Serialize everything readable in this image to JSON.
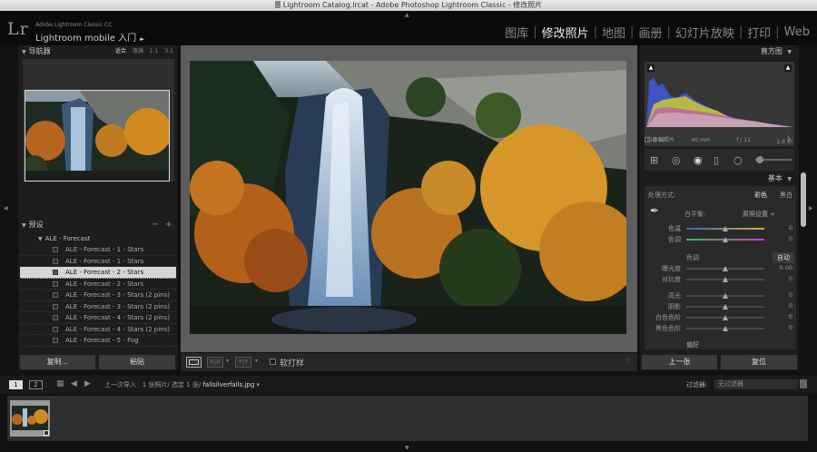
{
  "window": {
    "title": "Lightroom Catalog.lrcat - Adobe Photoshop Lightroom Classic - 修改照片"
  },
  "brand": {
    "logo": "Lr",
    "small": "Adobe Lightroom Classic CC",
    "big": "Lightroom mobile 入门",
    "arrow": "►"
  },
  "modules": [
    "图库",
    "修改照片",
    "地图",
    "画册",
    "幻灯片放映",
    "打印",
    "Web"
  ],
  "active_module": "修改照片",
  "navigator": {
    "title": "导航器",
    "options": [
      "适合",
      "填满",
      "1:1",
      "3:1"
    ],
    "selected_option": "适合"
  },
  "presets": {
    "title": "预设",
    "minus": "−",
    "plus": "+",
    "folder": "ALE - Forecast",
    "items": [
      "ALE - Forecast - 1 - Stars",
      "ALE - Forecast - 1 - Stars",
      "ALE - Forecast - 2 - Stars",
      "ALE - Forecast - 2 - Stars",
      "ALE - Forecast - 3 - Stars (2 pins)",
      "ALE - Forecast - 3 - Stars (2 pins)",
      "ALE - Forecast - 4 - Stars (2 pins)",
      "ALE - Forecast - 4 - Stars (2 pins)",
      "ALE - Forecast - 5 - Fog"
    ],
    "selected_index": 2
  },
  "left_buttons": {
    "copy": "复制...",
    "paste": "粘贴"
  },
  "toolbar": {
    "soft_proof": "软打样",
    "view_a": "R|R",
    "view_b": "Y|Y"
  },
  "histogram": {
    "title": "直方图",
    "iso": "ISO 50",
    "focal": "40 mm",
    "aperture": "f / 11",
    "shutter": "1.6 秒",
    "original_photo": "原始照片"
  },
  "basic": {
    "title": "基本",
    "treatment_label": "处理方式:",
    "treatment_color": "彩色",
    "treatment_bw": "黑白",
    "wb_label": "白平衡:",
    "wb_value": "原照设置 ÷",
    "temp_label": "色温",
    "tint_label": "色调",
    "temp_value": "0",
    "tint_value": "0",
    "tone_label": "色调",
    "auto": "自动",
    "exposure_label": "曝光度",
    "exposure_value": "0.00",
    "contrast_label": "对比度",
    "contrast_value": "0",
    "highlights_label": "高光",
    "highlights_value": "0",
    "shadows_label": "阴影",
    "shadows_value": "0",
    "whites_label": "白色色阶",
    "whites_value": "0",
    "blacks_label": "黑色色阶",
    "blacks_value": "0",
    "presence_label": "偏好"
  },
  "right_buttons": {
    "previous": "上一张",
    "reset": "复位"
  },
  "filmstrip_bar": {
    "screen1": "1",
    "screen2": "2",
    "source": "上一次导入",
    "count": "1 张照片/ 选定 1 张/",
    "filename": "fallsilverfalls.jpg",
    "filename_arrow": "▾",
    "filter_label": "过滤器:",
    "filter_value": "无过滤器"
  },
  "colors": {
    "panel": "#1d1d1d",
    "center_bg": "#5d5d5d",
    "selected_row": "#d6d6d6",
    "hist_blue": "#3f59d6",
    "hist_yellow": "#d7d12b",
    "hist_magenta": "#c23fc9"
  }
}
